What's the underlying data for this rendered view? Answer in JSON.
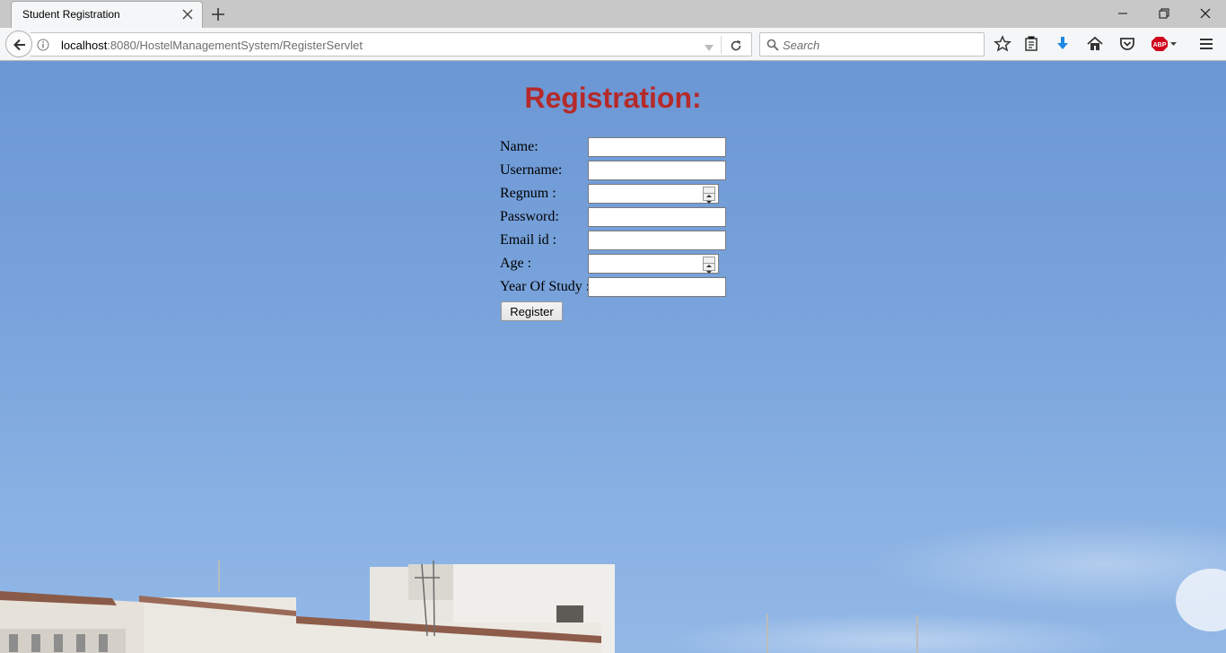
{
  "browser": {
    "tab_title": "Student Registration",
    "url_host": "localhost",
    "url_rest": ":8080/HostelManagementSystem/RegisterServlet",
    "search_placeholder": "Search",
    "adblock_label": "ABP"
  },
  "page": {
    "title": "Registration:",
    "fields": {
      "name": "Name:",
      "username": "Username:",
      "regnum": "Regnum :",
      "password": "Password:",
      "email": "Email id :",
      "age": "Age :",
      "year": "Year Of Study :"
    },
    "register_label": "Register"
  },
  "colors": {
    "title": "#b52a2a",
    "sky": "#6b97d4",
    "download_arrow": "#1e88e5",
    "abp_badge": "#d0021b"
  }
}
